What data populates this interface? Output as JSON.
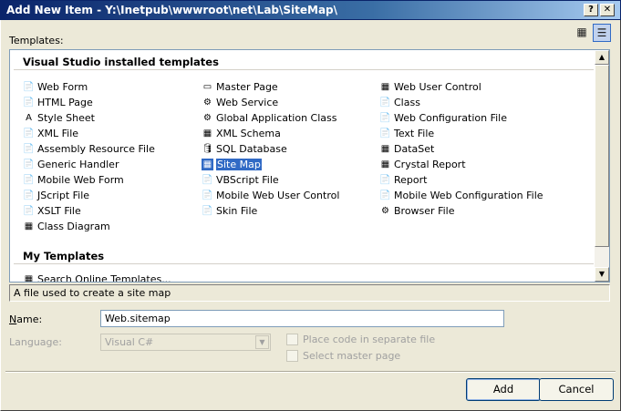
{
  "window": {
    "title": "Add New Item - Y:\\Inetpub\\wwwroot\\net\\Lab\\SiteMap\\",
    "help_glyph": "?",
    "close_glyph": "✕"
  },
  "templates_label": "Templates:",
  "view_buttons": {
    "large_icons": "large-icons-view-icon",
    "small_icons": "small-icons-view-icon"
  },
  "sections": {
    "installed": "Visual Studio installed templates",
    "my": "My Templates"
  },
  "templates": {
    "col1": [
      {
        "label": "Web Form",
        "icon": "📄"
      },
      {
        "label": "HTML Page",
        "icon": "📄"
      },
      {
        "label": "Style Sheet",
        "icon": "A"
      },
      {
        "label": "XML File",
        "icon": "📄"
      },
      {
        "label": "Assembly Resource File",
        "icon": "📄"
      },
      {
        "label": "Generic Handler",
        "icon": "📄"
      },
      {
        "label": "Mobile Web Form",
        "icon": "📄"
      },
      {
        "label": "JScript File",
        "icon": "📄"
      },
      {
        "label": "XSLT File",
        "icon": "📄"
      },
      {
        "label": "Class Diagram",
        "icon": "▦"
      }
    ],
    "col2": [
      {
        "label": "Master Page",
        "icon": "▭"
      },
      {
        "label": "Web Service",
        "icon": "⚙"
      },
      {
        "label": "Global Application Class",
        "icon": "⚙"
      },
      {
        "label": "XML Schema",
        "icon": "▦"
      },
      {
        "label": "SQL Database",
        "icon": "🛢"
      },
      {
        "label": "Site Map",
        "icon": "▦"
      },
      {
        "label": "VBScript File",
        "icon": "📄"
      },
      {
        "label": "Mobile Web User Control",
        "icon": "📄"
      },
      {
        "label": "Skin File",
        "icon": "📄"
      }
    ],
    "col3": [
      {
        "label": "Web User Control",
        "icon": "▦"
      },
      {
        "label": "Class",
        "icon": "📄"
      },
      {
        "label": "Web Configuration File",
        "icon": "📄"
      },
      {
        "label": "Text File",
        "icon": "📄"
      },
      {
        "label": "DataSet",
        "icon": "▦"
      },
      {
        "label": "Crystal Report",
        "icon": "▦"
      },
      {
        "label": "Report",
        "icon": "📄"
      },
      {
        "label": "Mobile Web Configuration File",
        "icon": "📄"
      },
      {
        "label": "Browser File",
        "icon": "⚙"
      }
    ],
    "my": [
      {
        "label": "Search Online Templates...",
        "icon": "▦"
      }
    ]
  },
  "selected_template": "Site Map",
  "description": "A file used to create a site map",
  "name_field": {
    "label": "Name:",
    "value": "Web.sitemap"
  },
  "language_field": {
    "label": "Language:",
    "value": "Visual C#"
  },
  "options": {
    "separate_file": "Place code in separate file",
    "master_page": "Select master page"
  },
  "buttons": {
    "add": "Add",
    "cancel": "Cancel"
  },
  "colors": {
    "selection": "#316ac5",
    "titlebar": "#0a246a",
    "dialog_bg": "#ece9d8"
  }
}
